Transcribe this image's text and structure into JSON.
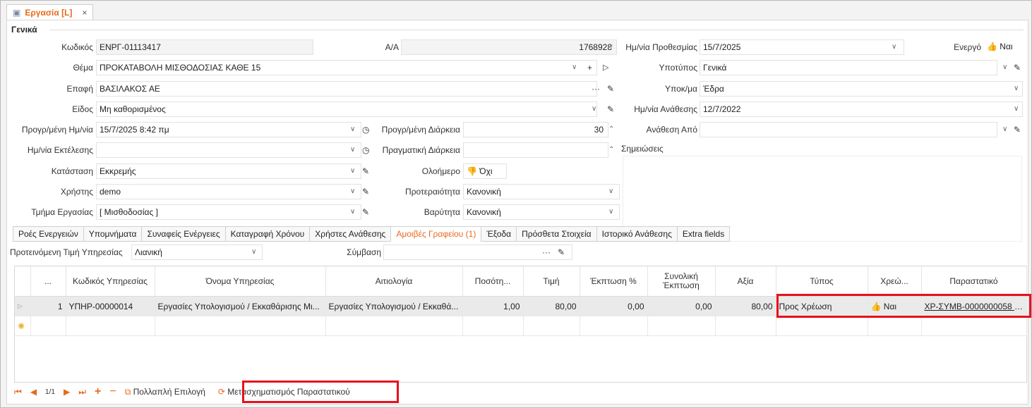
{
  "tab": {
    "title": "Εργασία [L]",
    "close": "×"
  },
  "section": {
    "title": "Γενικά"
  },
  "fields": {
    "code_label": "Κωδικός",
    "code_value": "ΕΝΡΓ-01113417",
    "aa_label": "Α/Α",
    "aa_value": "1768928",
    "deadline_label": "Ημ/νία Προθεσμίας",
    "deadline_value": "15/7/2025",
    "active_label": "Ενεργό",
    "active_value": "Ναι",
    "subject_label": "Θέμα",
    "subject_value": "ΠΡΟΚΑΤΑΒΟΛΗ ΜΙΣΘΟΔΟΣΙΑΣ ΚΑΘΕ 15",
    "subtype_label": "Υποτύπος",
    "subtype_value": "Γενικά",
    "contact_label": "Επαφή",
    "contact_value": "ΒΑΣΙΛΑΚΟΣ ΑΕ",
    "branch_label": "Υποκ/μα",
    "branch_value": "Έδρα",
    "kind_label": "Είδος",
    "kind_value": "Μη καθορισμένος",
    "assign_date_label": "Ημ/νία Ανάθεσης",
    "assign_date_value": "12/7/2022",
    "planned_date_label": "Προγρ/μένη Ημ/νία",
    "planned_date_value": "15/7/2025 8:42 πμ",
    "planned_dur_label": "Προγρ/μένη Διάρκεια",
    "planned_dur_value": "30",
    "assigned_by_label": "Ανάθεση Από",
    "assigned_by_value": "",
    "exec_date_label": "Ημ/νία Εκτέλεσης",
    "exec_date_value": "",
    "actual_dur_label": "Πραγματική Διάρκεια",
    "actual_dur_value": "",
    "notes_label": "Σημειώσεις",
    "status_label": "Κατάσταση",
    "status_value": "Εκκρεμής",
    "allday_label": "Ολοήμερο",
    "allday_value": "Όχι",
    "user_label": "Χρήστης",
    "user_value": "demo",
    "priority_label": "Προτεραιότητα",
    "priority_value": "Κανονική",
    "dept_label": "Τμήμα Εργασίας",
    "dept_value": "[ Μισθοδοσίας ]",
    "severity_label": "Βαρύτητα",
    "severity_value": "Κανονική"
  },
  "tabs": [
    "Ροές Ενεργειών",
    "Υπομνήματα",
    "Συναφείς Ενέργειες",
    "Καταγραφή Χρόνου",
    "Χρήστες Ανάθεσης",
    "Αμοιβές Γραφείου (1)",
    "Έξοδα",
    "Πρόσθετα Στοιχεία",
    "Ιστορικό Ανάθεσης",
    "Extra fields"
  ],
  "fees": {
    "price_label": "Προτεινόμενη Τιμή Υπηρεσίας",
    "price_value": "Λιανική",
    "contract_label": "Σύμβαση",
    "contract_value": ""
  },
  "grid": {
    "headers": [
      "...",
      "Κωδικός Υπηρεσίας",
      "Όνομα Υπηρεσίας",
      "Αιτιολογία",
      "Ποσότη...",
      "Τιμή",
      "Έκπτωση %",
      "Συνολική Έκπτωση",
      "Αξία",
      "Τύπος",
      "Χρεώ...",
      "Παραστατικό"
    ],
    "row": {
      "n": "1",
      "code": "ΥΠΗΡ-00000014",
      "name": "Εργασίες Υπολογισμού / Εκκαθάρισης Μι...",
      "reason": "Εργασίες Υπολογισμού / Εκκαθά...",
      "qty": "1,00",
      "price": "80,00",
      "disc_pct": "0,00",
      "disc_total": "0,00",
      "value": "80,00",
      "type": "Προς Χρέωση",
      "charge": "Ναι",
      "doc": "ΧΡ-ΣΥΜΒ-0000000058 (..."
    }
  },
  "nav": {
    "page": "1/1",
    "multi": "Πολλαπλή Επιλογή",
    "transform": "Μετασχηματισμός Παραστατικού"
  },
  "colors": {
    "accent": "#e86a1c",
    "highlight": "#e8101c"
  }
}
